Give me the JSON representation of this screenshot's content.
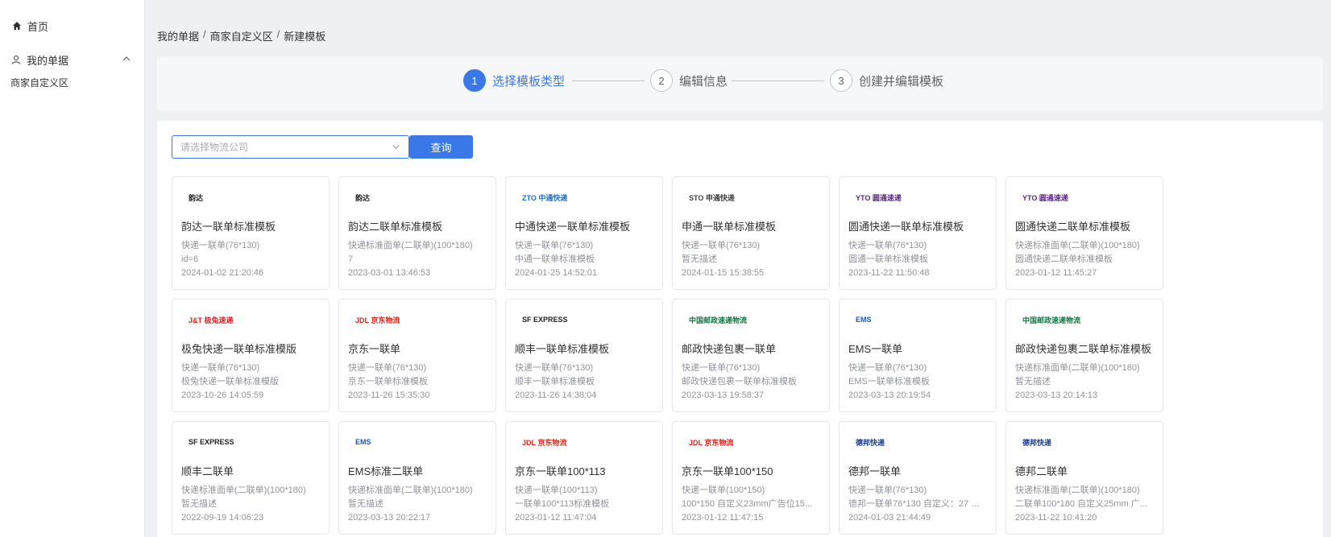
{
  "sidebar": {
    "home_label": "首页",
    "bills_label": "我的单据",
    "sub_label": "商家自定义区"
  },
  "breadcrumb": [
    "我的单据",
    "商家自定义区",
    "新建模板"
  ],
  "steps": [
    {
      "num": "1",
      "label": "选择模板类型"
    },
    {
      "num": "2",
      "label": "编辑信息"
    },
    {
      "num": "3",
      "label": "创建并编辑模板"
    }
  ],
  "search": {
    "placeholder": "请选择物流公司",
    "button_label": "查询"
  },
  "colors": {
    "primary": "#3b78e7"
  },
  "cards": [
    {
      "logo": "韵达",
      "logo_color": "#222",
      "title": "韵达一联单标准模板",
      "l1": "快递一联单(76*130)",
      "l2": "id=6",
      "l3": "2024-01-02 21:20:46"
    },
    {
      "logo": "韵达",
      "logo_color": "#222",
      "title": "韵达二联单标准模板",
      "l1": "快递标准面单(二联单)(100*180)",
      "l2": "7",
      "l3": "2023-03-01 13:46:53"
    },
    {
      "logo": "ZTO 中通快递",
      "logo_color": "#1b6ecb",
      "title": "中通快递一联单标准模板",
      "l1": "快递一联单(76*130)",
      "l2": "中通一联单标准模板",
      "l3": "2024-01-25 14:52:01"
    },
    {
      "logo": "STO 申通快递",
      "logo_color": "#444",
      "title": "申通一联单标准模板",
      "l1": "快递一联单(76*130)",
      "l2": "暂无描述",
      "l3": "2024-01-15 15:38:55"
    },
    {
      "logo": "YTO 圆通速递",
      "logo_color": "#5b2a86",
      "title": "圆通快递一联单标准模板",
      "l1": "快递一联单(76*130)",
      "l2": "圆通一联单标准模板",
      "l3": "2023-11-22 11:50:48"
    },
    {
      "logo": "YTO 圆通速递",
      "logo_color": "#5b2a86",
      "title": "圆通快递二联单标准模板",
      "l1": "快递标准面单(二联单)(100*180)",
      "l2": "圆通快递二联单标准模板",
      "l3": "2023-01-12 11:45:27"
    },
    {
      "logo": "J&T 极兔速递",
      "logo_color": "#e02020",
      "title": "极兔快递一联单标准模版",
      "l1": "快递一联单(76*130)",
      "l2": "极兔快递一联单标准模版",
      "l3": "2023-10-26 14:05:59"
    },
    {
      "logo": "JDL 京东物流",
      "logo_color": "#e1251b",
      "title": "京东一联单",
      "l1": "快递一联单(76*130)",
      "l2": "京东一联单标准模板",
      "l3": "2023-11-26 15:35:30"
    },
    {
      "logo": "SF EXPRESS",
      "logo_color": "#222",
      "title": "顺丰一联单标准模板",
      "l1": "快递一联单(76*130)",
      "l2": "顺丰一联单标准模板",
      "l3": "2023-11-26 14:38:04"
    },
    {
      "logo": "中国邮政速递物流",
      "logo_color": "#0a7a3e",
      "title": "邮政快递包裹一联单",
      "l1": "快递一联单(76*130)",
      "l2": "邮政快递包裹一联单标准模板",
      "l3": "2023-03-13 19:58:37"
    },
    {
      "logo": "EMS",
      "logo_color": "#1d58b5",
      "title": "EMS一联单",
      "l1": "快递一联单(76*130)",
      "l2": "EMS一联单标准模板",
      "l3": "2023-03-13 20:19:54"
    },
    {
      "logo": "中国邮政速递物流",
      "logo_color": "#0a7a3e",
      "title": "邮政快递包裹二联单标准模板",
      "l1": "快递标准面单(二联单)(100*180)",
      "l2": "暂无描述",
      "l3": "2023-03-13 20:14:13"
    },
    {
      "logo": "SF EXPRESS",
      "logo_color": "#222",
      "title": "顺丰二联单",
      "l1": "快递标准面单(二联单)(100*180)",
      "l2": "暂无描述",
      "l3": "2022-09-19 14:06:23"
    },
    {
      "logo": "EMS",
      "logo_color": "#1d58b5",
      "title": "EMS标准二联单",
      "l1": "快递标准面单(二联单)(100*180)",
      "l2": "暂无描述",
      "l3": "2023-03-13 20:22:17"
    },
    {
      "logo": "JDL 京东物流",
      "logo_color": "#e1251b",
      "title": "京东一联单100*113",
      "l1": "快递一联单(100*113)",
      "l2": "一联单100*113标准模板",
      "l3": "2023-01-12 11:47:04"
    },
    {
      "logo": "JDL 京东物流",
      "logo_color": "#e1251b",
      "title": "京东一联单100*150",
      "l1": "快递一联单(100*150)",
      "l2": "100*150 自定义23mm广告位15...",
      "l3": "2023-01-12 11:47:15"
    },
    {
      "logo": "德邦快递",
      "logo_color": "#1a3e8c",
      "title": "德邦一联单",
      "l1": "快递一联单(76*130)",
      "l2": "德邦一联单76*130 自定义：27 广...",
      "l3": "2024-01-03 21:44:49"
    },
    {
      "logo": "德邦快递",
      "logo_color": "#1a3e8c",
      "title": "德邦二联单",
      "l1": "快递标准面单(二联单)(100*180)",
      "l2": "二联单100*180 自定义25mm 广...",
      "l3": "2023-11-22 10:41:20"
    }
  ]
}
